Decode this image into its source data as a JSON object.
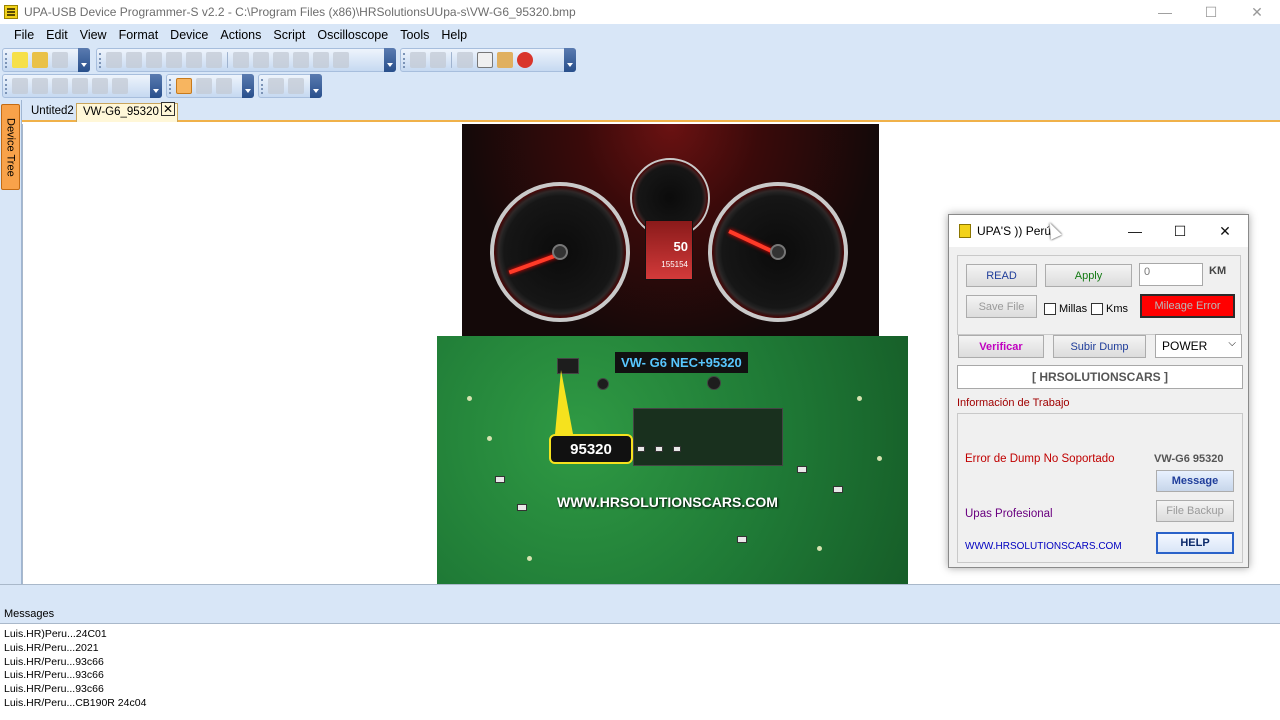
{
  "window": {
    "title": "UPA-USB Device Programmer-S v2.2 - C:\\Program Files (x86)\\HRSolutionsUUpa-s\\VW-G6_95320.bmp",
    "minimize": "—",
    "maximize": "☐",
    "close": "✕"
  },
  "menu": [
    "File",
    "Edit",
    "View",
    "Format",
    "Device",
    "Actions",
    "Script",
    "Oscilloscope",
    "Tools",
    "Help"
  ],
  "sidebar": {
    "device_tree_label": "Device Tree"
  },
  "tabs": [
    {
      "label": "Untited2",
      "active": false
    },
    {
      "label": "VW-G6_95320",
      "active": true
    }
  ],
  "tab_close_glyph": "✕",
  "image": {
    "chip_caption": "VW- G6   NEC+95320",
    "callout_label": "95320",
    "url_text": "WWW.HRSOLUTIONSCARS.COM",
    "lcd_speed": "50",
    "lcd_odo": "155154"
  },
  "messages": {
    "header": "Messages",
    "lines": [
      "Luis.HR)Peru...24C01",
      "Luis.HR/Peru...2021",
      "Luis.HR/Peru...93c66",
      "Luis.HR/Peru...93c66",
      "Luis.HR/Peru...93c66",
      "Luis.HR/Peru...CB190R 24c04"
    ]
  },
  "dialog": {
    "title": "UPA'S )) Perú",
    "read_label": "READ",
    "apply_label": "Apply",
    "km_value": "0",
    "km_unit": "KM",
    "save_file_label": "Save File",
    "millas_label": "Millas",
    "kms_label": "Kms",
    "mileage_error_label": "Mileage Error",
    "verificar_label": "Verificar",
    "subir_dump_label": "Subir Dump",
    "power_value": "POWER",
    "brand_label": "[  HRSOLUTIONSCARS ]",
    "info_heading": "Información de Trabajo",
    "error_text": "Error de Dump No Soportado",
    "device_label": "VW-G6 95320",
    "message_label": "Message",
    "upas_text": "Upas Profesional",
    "file_backup_label": "File Backup",
    "url_text": "WWW.HRSOLUTIONSCARS.COM",
    "help_label": "HELP",
    "colors": {
      "mileage_error_bg": "#ff0000",
      "verificar_text": "#c000c0",
      "heading_text": "#a00000",
      "upas_text": "#6a0080",
      "url_text": "#0000c0"
    }
  }
}
